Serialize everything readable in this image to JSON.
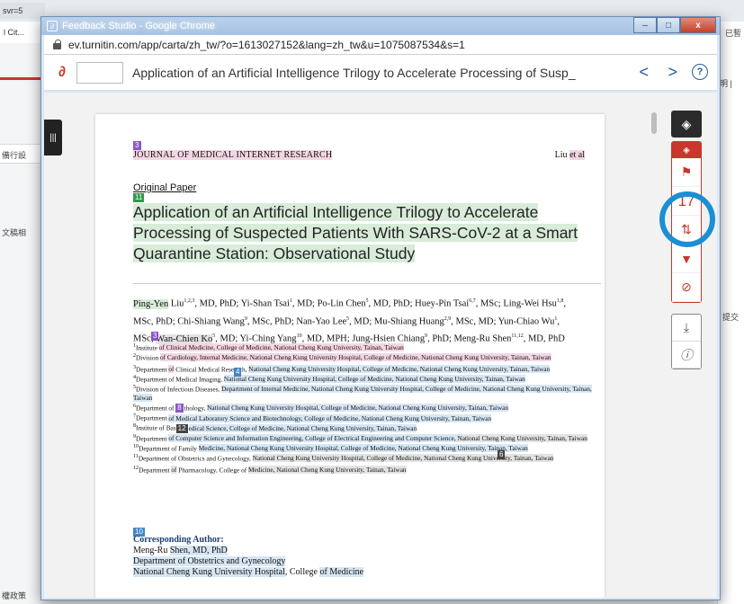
{
  "background": {
    "url_fragment": "svr=5",
    "tab_fragment": "l Cit...",
    "left_text_1": "備行設",
    "left_text_2": "文稿相",
    "right_text_1": "已暫",
    "right_text_2": "明 |",
    "right_text_3": "提交",
    "bottom_left": "權政策"
  },
  "window": {
    "title": "Feedback Studio - Google Chrome",
    "min_label": "–",
    "max_label": "□",
    "close_label": "x",
    "url": "ev.turnitin.com/app/carta/zh_tw/?o=1613027152&lang=zh_tw&u=1075087534&s=1"
  },
  "header": {
    "doc_title": "Application of an Artificial Intelligence Trilogy to Accelerate Processing of Susp_",
    "prev": "<",
    "next": ">",
    "help": "?"
  },
  "rail": {
    "layers_icon": "layers-icon",
    "score": "17",
    "colors": {
      "red": "#c9362b",
      "ring": "#1b8fd3"
    }
  },
  "paper": {
    "tag_3": "3",
    "journal": "JOURNAL OF MEDICAL INTERNET RESEARCH",
    "running_author_1": "Liu ",
    "running_author_2": "et al",
    "original_paper": "Original Paper",
    "tag_11": "11",
    "title": "Application of an Artificial Intelligence Trilogy to Accelerate Processing of Suspected Patients With SARS-CoV-2 at a Smart Quarantine Station: Observational Study",
    "authors_1": "Ping-Yen",
    "authors_2": " Liu",
    "authors_3": "1,2,3",
    "authors_4": ", MD, PhD; Yi-Shan Tsai",
    "authors_5": "1",
    "authors_6": ", MD; Po-Lin Chen",
    "authors_7": "5",
    "authors_8": ", MD, PhD; Huey-Pin Tsai",
    "authors_9": "6,7",
    "authors_10": ", MSc; Ling-Wei Hsu",
    "authors_11": "1,8",
    "authors_12": ",",
    "authors_line2": "MSc, PhD; Chi-Shiang Wang",
    "authors_line2b": "9",
    "authors_line2c": ", MSc, PhD; Nan-Yao Lee",
    "authors_line2d": "5",
    "authors_line2e": ", MD; Mu-Shiang Huang",
    "authors_line2f": "2,9",
    "authors_line2g": ", MSc, MD; Yun-Chiao Wu",
    "authors_line2h": "1",
    "authors_line2i": ",",
    "authors_line3a": "MSc; ",
    "authors_line3b": "Wan-Chien Ko",
    "authors_line3c": "5",
    "authors_line3d": ", MD; Yi-Ching Yang",
    "authors_line3e": "10",
    "authors_line3f": ", MD, MPH; Jung-Hsien Chiang",
    "authors_line3g": "9",
    "authors_line3h": ", PhD; Meng-Ru Shen",
    "authors_line3i": "11,12",
    "authors_line3j": ", MD, PhD",
    "tag_4": "4",
    "tag_8": "8",
    "tag_12": "12",
    "tag_6": "6",
    "tag_10": "10",
    "aff1a": "1",
    "aff1b": "Institute ",
    "aff1c": "of Clinical Medicine, College of Medicine, National Cheng Kung University, Tainan, Taiwan",
    "aff2a": "2",
    "aff2b": "Division ",
    "aff2c": "of Cardiology, Internal Medicine, National Cheng Kung University Hospital, College of Medicine, National Cheng Kung University, Tainan, Taiwan",
    "aff3a": "3",
    "aff3b": "Department ",
    "aff3c": "of",
    "aff3d": " Clinical Medical Research, ",
    "aff3e": "National Cheng Kung University Hospital, College of Medicine, National Cheng Kung University, Tainan, Taiwan",
    "aff4a": "4",
    "aff4b": "Department of Medical Imaging, ",
    "aff4c": "National Cheng Kung University Hospital, College of Medicine, National Cheng Kung University, Tainan, Taiwan",
    "aff5a": "5",
    "aff5b": "Division of Infectious Diseases, ",
    "aff5c": "Department of Internal Medicine, National Cheng Kung University Hospital, College of Medicine, National Cheng Kung University, Tainan, Taiwan",
    "aff6a": "6",
    "aff6b": "Department of ",
    "aff6c": "thology, ",
    "aff6d": "National Cheng Kung University Hospital, College of Medicine, National Cheng Kung University, Tainan, Taiwan",
    "aff7a": "7",
    "aff7b": "Department ",
    "aff7c": "of Medical Laboratory Science and Biotechnology, College of Medicine, National Cheng Kung University, Tainan, Taiwan",
    "aff8a": "8",
    "aff8b": "Institute of Bas",
    "aff8c": "edical Science, College of Medicine, National Cheng Kung University, Tainan, Taiwan",
    "aff9a": "9",
    "aff9b": "Department ",
    "aff9c": "of Computer Science and Information Engineering, College of Electrical Engineering and Computer Science, ",
    "aff9d": "National Cheng Kung University, Tainan, Taiwan",
    "aff10a": "10",
    "aff10b": "Department of Family ",
    "aff10c": "Medicine, National Cheng Kung University Hospital, College of Medicine, National Cheng Kung University, Tainan, Taiwan",
    "aff11a": "11",
    "aff11b": "Department of Obstetrics and Gynecology, ",
    "aff11c": "National Cheng Kung University Hospital, College of Medicine, National Cheng Kung University, Tainan, Taiwan",
    "aff12a": "12",
    "aff12b": "Department ",
    "aff12c": "of",
    "aff12d": " Pharmacology, College of ",
    "aff12e": "Medicine, National Cheng Kung University, Tainan, Taiwan",
    "corr_title": "Corresponding Author:",
    "corr_name_a": "Meng-Ru ",
    "corr_name_b": "Shen, MD, PhD",
    "corr_dept_a": "Department",
    "corr_dept_b": " of Obstetrics and Gynecology",
    "corr_inst_a": "National Cheng Kung University Hospital",
    "corr_inst_b": ", College ",
    "corr_inst_c": "of Medicine"
  }
}
